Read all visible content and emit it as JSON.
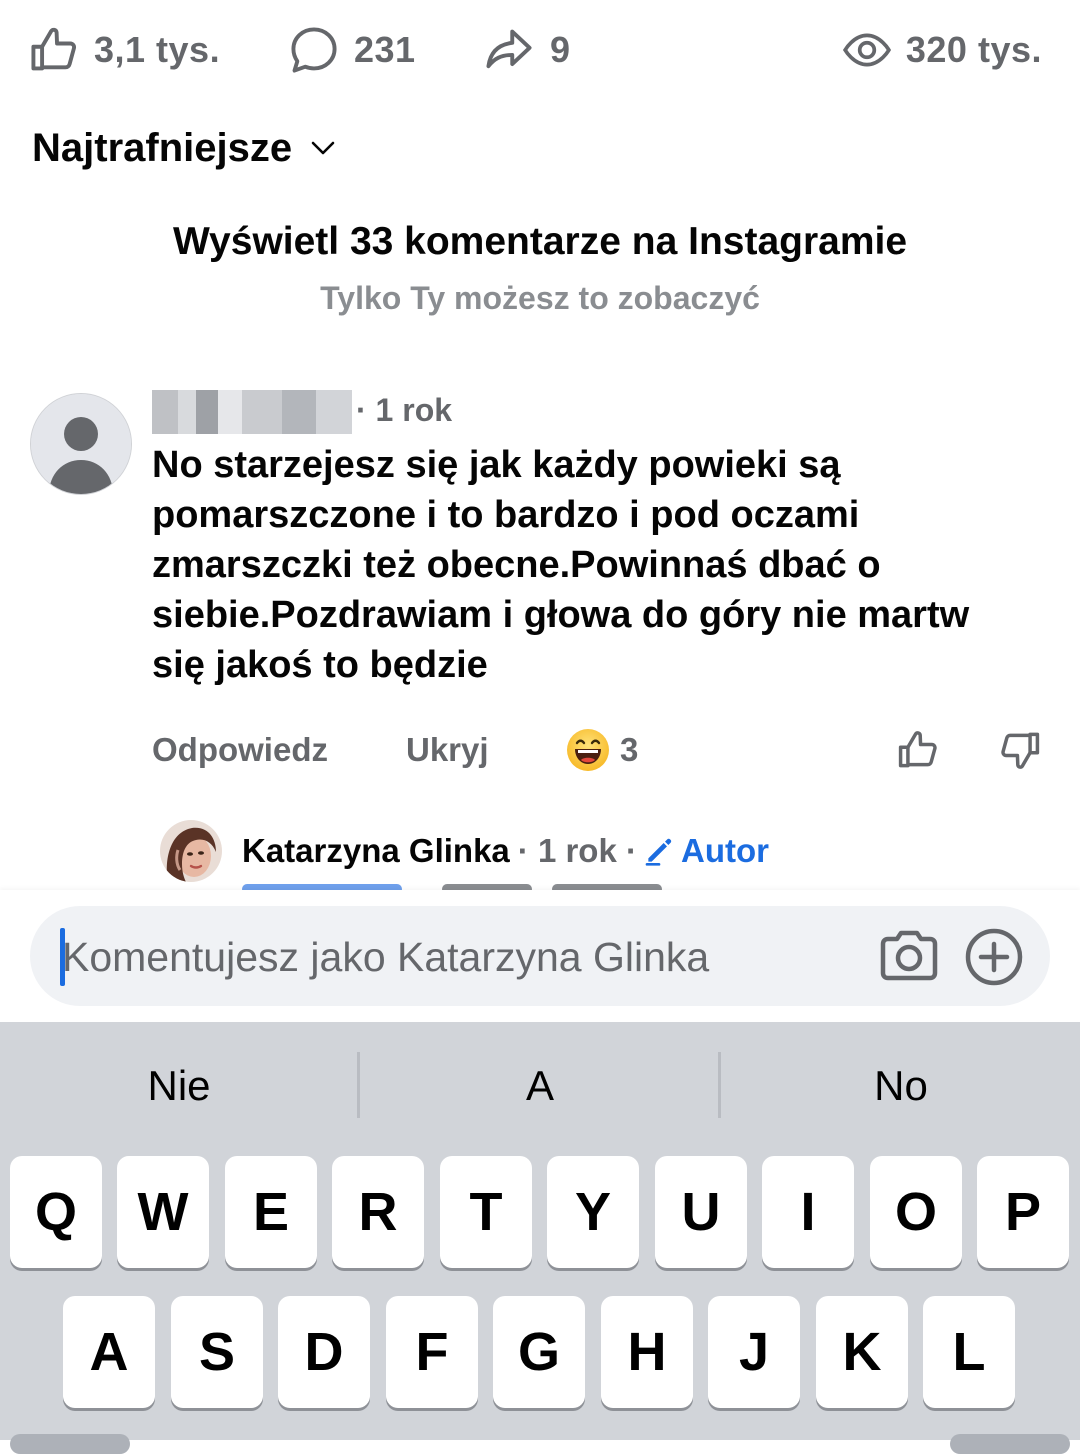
{
  "stats": {
    "likes": "3,1 tys.",
    "comments": "231",
    "shares": "9",
    "views": "320 tys."
  },
  "sort": {
    "label": "Najtrafniejsze"
  },
  "instagram_notice": {
    "title": "Wyświetl 33 komentarze na Instagramie",
    "subtitle": "Tylko Ty możesz to zobaczyć"
  },
  "comment": {
    "time": "· 1 rok",
    "text": "No starzejesz się jak każdy powieki są pomarszczone i to bardzo i pod oczami zmarszczki też obecne.Powinnaś dbać o siebie.Pozdrawiam i głowa do góry nie martw się jakoś to będzie",
    "reply_label": "Odpowiedz",
    "hide_label": "Ukryj",
    "reaction_count": "3"
  },
  "reply": {
    "author": "Katarzyna Glinka",
    "time": "· 1 rok ·",
    "badge": "Autor"
  },
  "composer": {
    "placeholder": "Komentujesz jako Katarzyna Glinka"
  },
  "keyboard": {
    "suggestions": [
      "Nie",
      "A",
      "No"
    ],
    "row1": [
      "Q",
      "W",
      "E",
      "R",
      "T",
      "Y",
      "U",
      "I",
      "O",
      "P"
    ],
    "row2": [
      "A",
      "S",
      "D",
      "F",
      "G",
      "H",
      "J",
      "K",
      "L"
    ]
  },
  "colors": {
    "link_blue": "#1b6ce0",
    "secondary_text": "#65676b",
    "keyboard_bg": "#d1d4d9"
  }
}
